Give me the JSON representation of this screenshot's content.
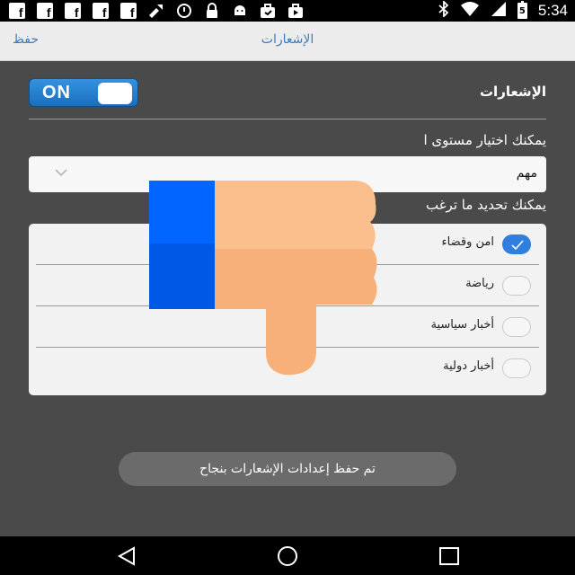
{
  "status_bar": {
    "time": "5:34",
    "battery_level": "5",
    "left_icons": [
      "facebook-icon",
      "facebook-icon",
      "facebook-icon",
      "facebook-icon",
      "facebook-icon",
      "phone-tools-icon",
      "alarm-icon",
      "lock-icon",
      "android-icon",
      "briefcase-icon",
      "briefcase-icon"
    ],
    "right_icons": [
      "bluetooth-icon",
      "wifi-icon",
      "signal-icon",
      "battery-icon"
    ]
  },
  "action_bar": {
    "save_label": "حفظ",
    "title": "الإشعارات"
  },
  "notifications": {
    "toggle_label": "ON",
    "toggle_on": true,
    "label": "الإشعارات",
    "level_hint": "يمكنك اختيار مستوى ا",
    "level_value": "مهم",
    "topics_hint": "يمكنك تحديد ما ترغب",
    "topics": [
      {
        "label": "امن وقضاء",
        "checked": true
      },
      {
        "label": "رياضة",
        "checked": false
      },
      {
        "label": "أخبار سياسية",
        "checked": false
      },
      {
        "label": "أخبار دولية",
        "checked": false
      }
    ]
  },
  "toast": {
    "text": "تم حفظ إعدادات الإشعارات بنجاح"
  },
  "colors": {
    "accent": "#3b7dbf",
    "toggle_blue": "#1a6fbe",
    "checked_blue": "#2f7ee0",
    "thumb_skin": "#f7b07a",
    "thumb_sleeve": "#0066ff"
  }
}
